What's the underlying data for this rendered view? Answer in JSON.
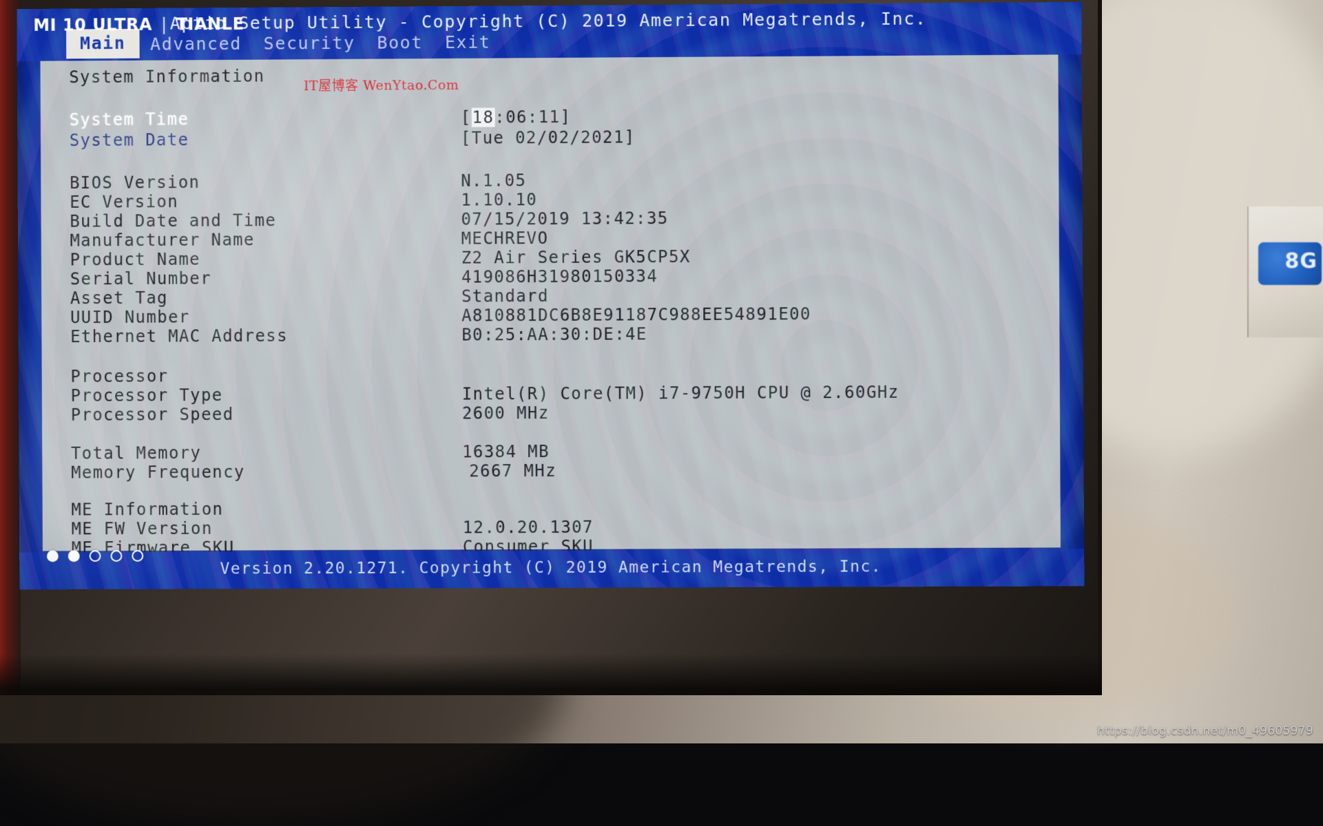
{
  "window": {
    "app_title": "Aptio Setup Utility - Copyright (C) 2019 American Megatrends, Inc.",
    "tabs": [
      {
        "label": "Main",
        "active": true
      },
      {
        "label": "Advanced",
        "active": false
      },
      {
        "label": "Security",
        "active": false
      },
      {
        "label": "Boot",
        "active": false
      },
      {
        "label": "Exit",
        "active": false
      }
    ]
  },
  "watermarks": {
    "blog_overlay": "IT屋博客 WenYtao.Com",
    "phone_model": "MI 10 ULTRA",
    "phone_separator": "|",
    "phone_user": "TIANLE",
    "csdn_url": "https://blog.csdn.net/m0_49605979"
  },
  "main": {
    "section_system_information": "System Information",
    "section_processor": "Processor",
    "section_me_information": "ME Information",
    "fields": {
      "system_time": {
        "label": "System Time",
        "value_open": "[",
        "value_hh": "18",
        "value_rest": ":06:11]"
      },
      "system_date": {
        "label": "System Date",
        "value": "[Tue 02/02/2021]"
      },
      "bios_version": {
        "label": "BIOS Version",
        "value": "N.1.05"
      },
      "ec_version": {
        "label": "EC Version",
        "value": "1.10.10"
      },
      "build_date_and_time": {
        "label": "Build Date and Time",
        "value": "07/15/2019 13:42:35"
      },
      "manufacturer_name": {
        "label": "Manufacturer Name",
        "value": "MECHREVO"
      },
      "product_name": {
        "label": "Product Name",
        "value": "Z2 Air Series GK5CP5X"
      },
      "serial_number": {
        "label": "Serial Number",
        "value": "419086H31980150334"
      },
      "asset_tag": {
        "label": "Asset Tag",
        "value": "Standard"
      },
      "uuid_number": {
        "label": "UUID Number",
        "value": "A810881DC6B8E91187C988EE54891E00"
      },
      "ethernet_mac_address": {
        "label": "Ethernet MAC Address",
        "value": "B0:25:AA:30:DE:4E"
      },
      "processor_type": {
        "label": "Processor Type",
        "value": "Intel(R) Core(TM) i7-9750H CPU @ 2.60GHz"
      },
      "processor_speed": {
        "label": "Processor Speed",
        "value": "2600 MHz"
      },
      "total_memory": {
        "label": "Total Memory",
        "value": "16384 MB"
      },
      "memory_frequency": {
        "label": "Memory Frequency",
        "value": "2667 MHz"
      },
      "me_fw_version": {
        "label": "ME FW Version",
        "value": "12.0.20.1307"
      },
      "me_firmware_sku": {
        "label": "ME Firmware SKU",
        "value": "Consumer SKU"
      }
    }
  },
  "footer": {
    "version_line": "Version 2.20.1271. Copyright (C) 2019 American Megatrends, Inc."
  },
  "desk": {
    "object_badge_text": "8G"
  },
  "colors": {
    "bios_blue": "#0e2ea8",
    "panel_gray": "#b7bcc1",
    "tab_active_bg": "#e7e6e1",
    "highlight_white": "#ffffff",
    "label_blue": "#20307e",
    "watermark_red": "#d4202a"
  }
}
